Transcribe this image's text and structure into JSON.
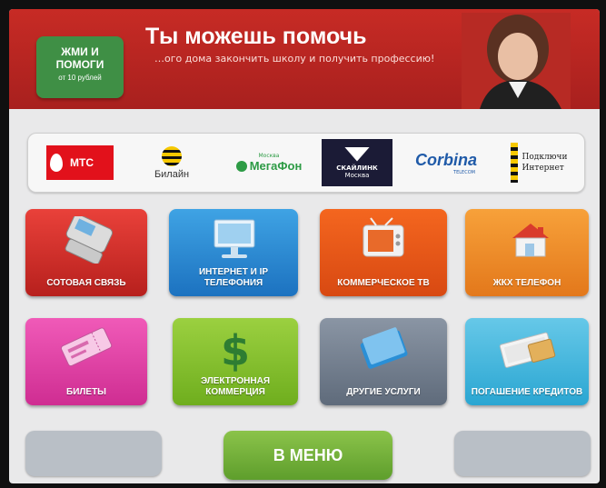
{
  "banner": {
    "button_line1": "ЖМИ И",
    "button_line2": "ПОМОГИ",
    "button_sub": "от 10 рублей",
    "title": "Ты можешь помочь",
    "subtitle": "…ого дома закончить школу и получить профессию!"
  },
  "operators": [
    {
      "name": "МТС"
    },
    {
      "name": "Билайн"
    },
    {
      "small": "Москва",
      "name": "МегаФон"
    },
    {
      "name": "СКАЙЛИНК",
      "sub": "Москва"
    },
    {
      "name": "Corbina",
      "sub": "TELECOM"
    },
    {
      "line1": "Подключи",
      "line2": "Интернет"
    }
  ],
  "tiles": [
    {
      "label": "СОТОВАЯ СВЯЗЬ"
    },
    {
      "label": "ИНТЕРНЕТ И IP ТЕЛЕФОНИЯ"
    },
    {
      "label": "КОММЕРЧЕСКОЕ ТВ"
    },
    {
      "label": "ЖКХ ТЕЛЕФОН"
    },
    {
      "label": "БИЛЕТЫ"
    },
    {
      "label": "ЭЛЕКТРОННАЯ КОММЕРЦИЯ"
    },
    {
      "label": "ДРУГИЕ УСЛУГИ"
    },
    {
      "label": "ПОГАШЕНИЕ КРЕДИТОВ"
    }
  ],
  "menu_button": "В МЕНЮ"
}
